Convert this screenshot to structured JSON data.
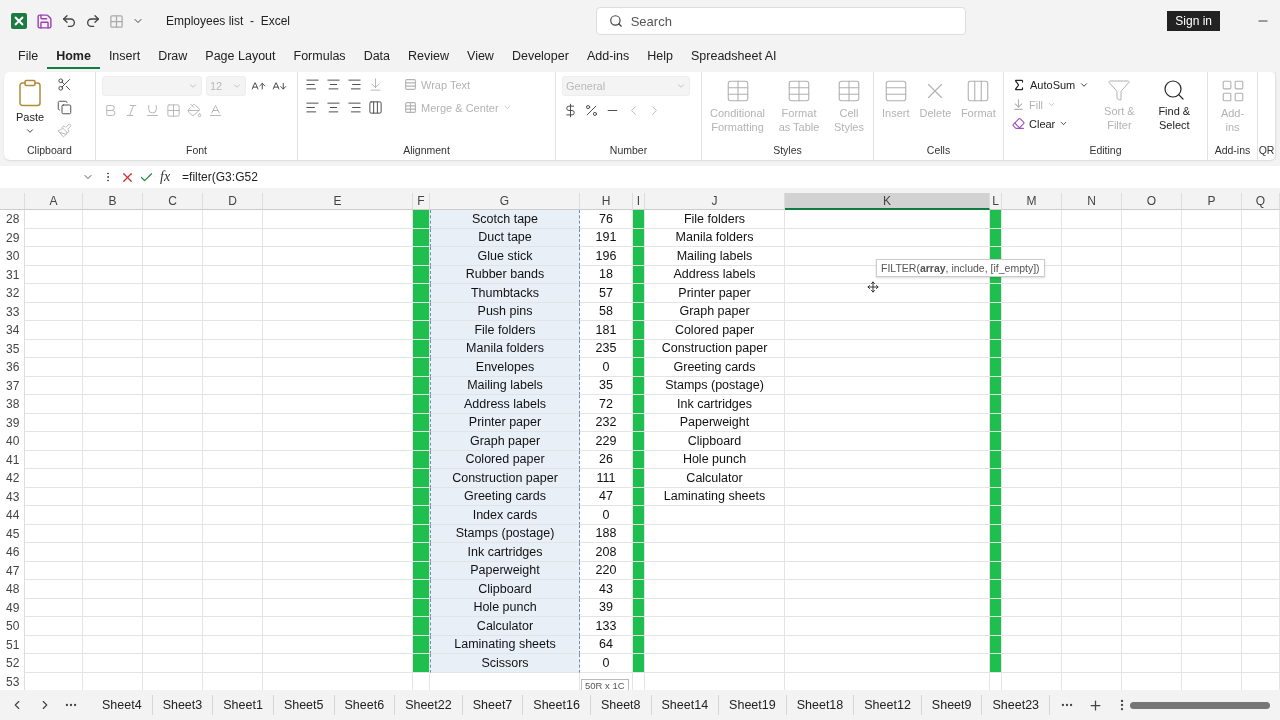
{
  "title_bar": {
    "document_title": "Employees list  -  Excel",
    "search_placeholder": "Search",
    "sign_in": "Sign in"
  },
  "menu_tabs": [
    {
      "label": "File",
      "selected": false
    },
    {
      "label": "Home",
      "selected": true
    },
    {
      "label": "Insert",
      "selected": false
    },
    {
      "label": "Draw",
      "selected": false
    },
    {
      "label": "Page Layout",
      "selected": false
    },
    {
      "label": "Formulas",
      "selected": false
    },
    {
      "label": "Data",
      "selected": false
    },
    {
      "label": "Review",
      "selected": false
    },
    {
      "label": "View",
      "selected": false
    },
    {
      "label": "Developer",
      "selected": false
    },
    {
      "label": "Add-ins",
      "selected": false
    },
    {
      "label": "Help",
      "selected": false
    },
    {
      "label": "Spreadsheet AI",
      "selected": false
    }
  ],
  "ribbon": [
    {
      "kind": "clipboard",
      "label": "Clipboard",
      "items": [
        {
          "label": "Paste",
          "disabled": false
        }
      ]
    },
    {
      "kind": "font",
      "label": "Font",
      "items": [
        {
          "disabled": true
        },
        {
          "value": "12",
          "disabled": true
        }
      ]
    },
    {
      "kind": "alignment",
      "label": "Alignment",
      "items": [
        {
          "label": "Wrap Text",
          "disabled": true
        },
        {
          "label": "Merge & Center",
          "disabled": true
        }
      ]
    },
    {
      "kind": "number",
      "label": "Number",
      "items": [
        {
          "value": "General",
          "disabled": true
        }
      ]
    },
    {
      "kind": "styles",
      "label": "Styles",
      "items": [
        {
          "label": "Conditional Formatting",
          "disabled": true
        },
        {
          "label": "Format as Table",
          "disabled": true
        },
        {
          "label": "Cell Styles",
          "disabled": true
        }
      ]
    },
    {
      "kind": "cells",
      "label": "Cells",
      "items": [
        {
          "label": "Insert",
          "disabled": true
        },
        {
          "label": "Delete",
          "disabled": true
        },
        {
          "label": "Format",
          "disabled": true
        }
      ]
    },
    {
      "kind": "editing",
      "label": "Editing",
      "items": [
        {
          "label": "AutoSum",
          "disabled": false
        },
        {
          "label": "Fill",
          "disabled": true
        },
        {
          "label": "Clear",
          "disabled": false
        },
        {
          "label": "Sort & Filter",
          "disabled": true
        },
        {
          "label": "Find & Select",
          "disabled": false
        }
      ]
    },
    {
      "kind": "addins",
      "label": "Add-ins",
      "items": [
        {
          "label": "Add-ins",
          "disabled": true
        }
      ]
    },
    {
      "kind": "partial",
      "label": "QR"
    }
  ],
  "formula_bar": {
    "fx": "fx",
    "formula": "=filter(G3:G52"
  },
  "columns": [
    {
      "label": "A",
      "kind": "blank",
      "selected": false
    },
    {
      "label": "B",
      "kind": "blank",
      "selected": false
    },
    {
      "label": "C",
      "kind": "blank",
      "selected": false
    },
    {
      "label": "D",
      "kind": "blank",
      "selected": false
    },
    {
      "label": "E",
      "kind": "blank",
      "selected": false
    },
    {
      "label": "F",
      "kind": "band",
      "selected": false
    },
    {
      "label": "G",
      "kind": "item",
      "selected": false,
      "referenced": true
    },
    {
      "label": "H",
      "kind": "qty",
      "selected": false
    },
    {
      "label": "I",
      "kind": "band",
      "selected": false
    },
    {
      "label": "J",
      "kind": "filtered",
      "selected": false
    },
    {
      "label": "K",
      "kind": "blank",
      "selected": true
    },
    {
      "label": "L",
      "kind": "band",
      "selected": false
    },
    {
      "label": "M",
      "kind": "blank",
      "selected": false
    },
    {
      "label": "N",
      "kind": "blank",
      "selected": false
    },
    {
      "label": "O",
      "kind": "blank",
      "selected": false
    },
    {
      "label": "P",
      "kind": "blank",
      "selected": false
    },
    {
      "label": "Q",
      "kind": "blank",
      "selected": false
    }
  ],
  "rows": [
    {
      "number": "28",
      "item": "Scotch tape",
      "qty": "76",
      "filtered": "File folders"
    },
    {
      "number": "29",
      "item": "Duct tape",
      "qty": "191",
      "filtered": "Manila folders"
    },
    {
      "number": "30",
      "item": "Glue stick",
      "qty": "196",
      "filtered": "Mailing labels"
    },
    {
      "number": "31",
      "item": "Rubber bands",
      "qty": "18",
      "filtered": "Address labels"
    },
    {
      "number": "32",
      "item": "Thumbtacks",
      "qty": "57",
      "filtered": "Printer paper"
    },
    {
      "number": "33",
      "item": "Push pins",
      "qty": "58",
      "filtered": "Graph paper"
    },
    {
      "number": "34",
      "item": "File folders",
      "qty": "181",
      "filtered": "Colored paper"
    },
    {
      "number": "35",
      "item": "Manila folders",
      "qty": "235",
      "filtered": "Construction paper"
    },
    {
      "number": "36",
      "item": "Envelopes",
      "qty": "0",
      "filtered": "Greeting cards"
    },
    {
      "number": "37",
      "item": "Mailing labels",
      "qty": "35",
      "filtered": "Stamps (postage)"
    },
    {
      "number": "38",
      "item": "Address labels",
      "qty": "72",
      "filtered": "Ink cartridges"
    },
    {
      "number": "39",
      "item": "Printer paper",
      "qty": "232",
      "filtered": "Paperweight"
    },
    {
      "number": "40",
      "item": "Graph paper",
      "qty": "229",
      "filtered": "Clipboard"
    },
    {
      "number": "41",
      "item": "Colored paper",
      "qty": "26",
      "filtered": "Hole punch"
    },
    {
      "number": "42",
      "item": "Construction paper",
      "qty": "111",
      "filtered": "Calculator"
    },
    {
      "number": "43",
      "item": "Greeting cards",
      "qty": "47",
      "filtered": "Laminating sheets"
    },
    {
      "number": "44",
      "item": "Index cards",
      "qty": "0"
    },
    {
      "number": "45",
      "item": "Stamps (postage)",
      "qty": "188"
    },
    {
      "number": "46",
      "item": "Ink cartridges",
      "qty": "208"
    },
    {
      "number": "47",
      "item": "Paperweight",
      "qty": "220"
    },
    {
      "number": "48",
      "item": "Clipboard",
      "qty": "43"
    },
    {
      "number": "49",
      "item": "Hole punch",
      "qty": "39"
    },
    {
      "number": "50",
      "item": "Calculator",
      "qty": "133"
    },
    {
      "number": "51",
      "item": "Laminating sheets",
      "qty": "64"
    },
    {
      "number": "52",
      "item": "Scissors",
      "qty": "0"
    },
    {
      "number": "53"
    }
  ],
  "function_tooltip": "FILTER(**array**, include, [if_empty])",
  "selection_size": "50R x 1C",
  "sheet_tabs": [
    {
      "label": "Sheet4",
      "selected": false
    },
    {
      "label": "Sheet3",
      "selected": false
    },
    {
      "label": "Sheet1",
      "selected": false
    },
    {
      "label": "Sheet5",
      "selected": false
    },
    {
      "label": "Sheet6",
      "selected": false
    },
    {
      "label": "Sheet22",
      "selected": false
    },
    {
      "label": "Sheet7",
      "selected": false
    },
    {
      "label": "Sheet16",
      "selected": false
    },
    {
      "label": "Sheet8",
      "selected": false
    },
    {
      "label": "Sheet14",
      "selected": false
    },
    {
      "label": "Sheet19",
      "selected": false
    },
    {
      "label": "Sheet18",
      "selected": false
    },
    {
      "label": "Sheet12",
      "selected": false
    },
    {
      "label": "Sheet9",
      "selected": false
    },
    {
      "label": "Sheet23",
      "selected": false
    }
  ]
}
